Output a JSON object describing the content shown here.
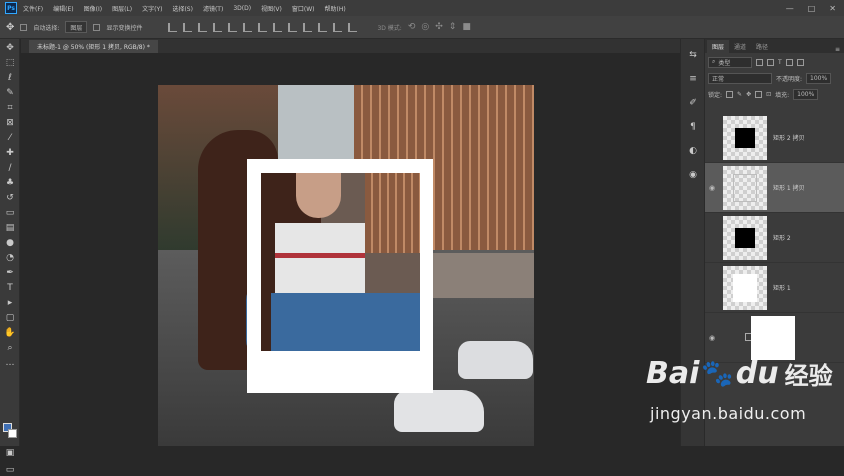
{
  "menubar": {
    "logo": "Ps",
    "items": [
      "文件(F)",
      "编辑(E)",
      "图像(I)",
      "图层(L)",
      "文字(Y)",
      "选择(S)",
      "滤镜(T)",
      "3D(D)",
      "视图(V)",
      "窗口(W)",
      "帮助(H)"
    ],
    "window_controls": [
      "—",
      "□",
      "✕"
    ]
  },
  "options": {
    "auto_select_label": "自动选择:",
    "auto_select_value": "图层",
    "transform_label": "显示变换控件",
    "mode_label": "3D 模式:"
  },
  "document": {
    "tab_title": "未标题-1 @ 50% (矩形 1 拷贝, RGB/8) *"
  },
  "panel": {
    "tabs": [
      "图层",
      "通道",
      "路径"
    ],
    "kind_label": "类型",
    "blend_mode": "正常",
    "opacity_label": "不透明度:",
    "opacity_value": "100%",
    "lock_label": "锁定:",
    "fill_label": "填充:",
    "fill_value": "100%"
  },
  "layers": [
    {
      "name": "矩形 2 拷贝",
      "thumb": "black",
      "visible": false,
      "selected": false
    },
    {
      "name": "矩形 1 拷贝",
      "thumb": "outline",
      "visible": true,
      "selected": true
    },
    {
      "name": "矩形 2",
      "thumb": "black",
      "visible": false,
      "selected": false
    },
    {
      "name": "矩形 1",
      "thumb": "white",
      "visible": false,
      "selected": false
    },
    {
      "name": "",
      "thumb": "white",
      "visible": true,
      "selected": false
    }
  ],
  "watermark": {
    "brand": "Bai",
    "brand_suffix": "du",
    "product": "经验",
    "url": "jingyan.baidu.com"
  }
}
